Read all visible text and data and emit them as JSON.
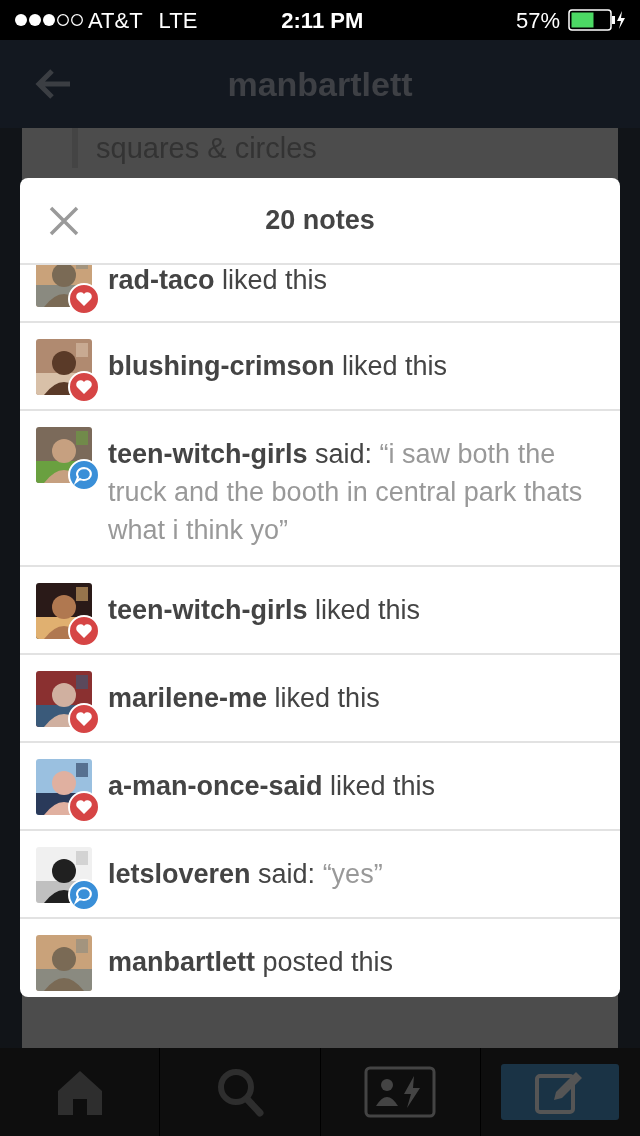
{
  "status_bar": {
    "carrier": "AT&T",
    "network": "LTE",
    "time": "2:11 PM",
    "battery": "57%"
  },
  "header": {
    "title": "manbartlett"
  },
  "background": {
    "text": "squares & circles"
  },
  "modal": {
    "title": "20 notes",
    "notes": [
      {
        "kind": "like",
        "user": "rad-taco",
        "action": "liked this",
        "cut": true
      },
      {
        "kind": "like",
        "user": "blushing-crimson",
        "action": "liked this"
      },
      {
        "kind": "reply",
        "user": "teen-witch-girls",
        "action": "said:",
        "quote": "“i saw both the truck and the booth in central park thats what i think yo”"
      },
      {
        "kind": "like",
        "user": "teen-witch-girls",
        "action": "liked this"
      },
      {
        "kind": "like",
        "user": "marilene-me",
        "action": "liked this"
      },
      {
        "kind": "like",
        "user": "a-man-once-said",
        "action": "liked this"
      },
      {
        "kind": "reply",
        "user": "letsloveren",
        "action": "said:",
        "quote": "“yes”"
      },
      {
        "kind": "post",
        "user": "manbartlett",
        "action": "posted this"
      }
    ]
  },
  "tab_bar": [
    {
      "kind": "home",
      "selected": false
    },
    {
      "kind": "search",
      "selected": false
    },
    {
      "kind": "activity",
      "selected": false
    },
    {
      "kind": "compose",
      "selected": true
    }
  ]
}
